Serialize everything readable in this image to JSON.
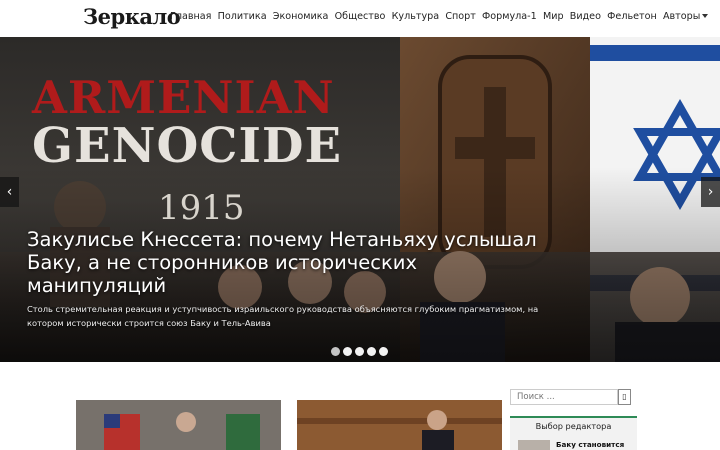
{
  "header": {
    "logo": "Зеркало",
    "nav": [
      "Главная",
      "Политика",
      "Экономика",
      "Общество",
      "Культура",
      "Спорт",
      "Формула-1",
      "Мир",
      "Видео",
      "Фельетон",
      "Авторы"
    ]
  },
  "hero": {
    "poster_line1": "ARMENIAN",
    "poster_line2": "GENOCIDE",
    "poster_year": "1915",
    "headline": "Закулисье Кнессета: почему Нетаньяху услышал Баку, а не сторонников исторических манипуляций",
    "subtitle": "Столь стремительная реакция и уступчивость израильского руководства объясняются глубоким прагматизмом, на котором исторически строится союз Баку и Тель-Авива",
    "prev_arrow": "‹",
    "next_arrow": "›",
    "dots_count": 5,
    "active_dot": 1
  },
  "sidebar": {
    "search_placeholder": "Поиск ...",
    "search_button": "▯",
    "editor_title": "Выбор редактора",
    "editor_item": "Баку становится"
  },
  "colors": {
    "flag_blue": "#1f4ea0",
    "accent_green": "#2e8b57",
    "poster_red": "#b01b1b"
  }
}
